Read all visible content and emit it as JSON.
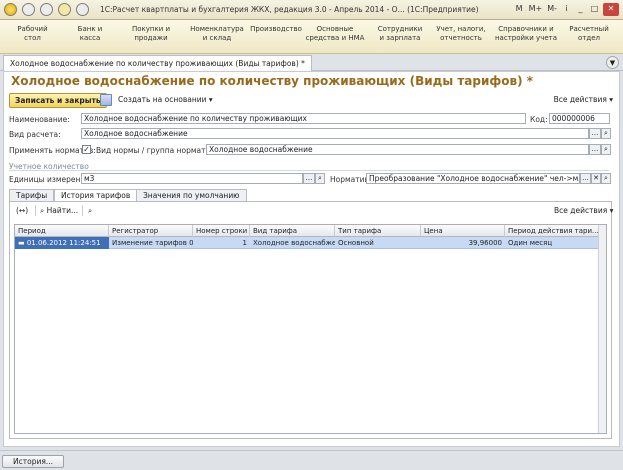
{
  "window": {
    "title": "1С:Расчет квартплаты и бухгалтерия ЖКХ, редакция 3.0 - Апрель 2014 - О...  (1С:Предприятие)",
    "controls": [
      "M",
      "M+",
      "M-",
      "i",
      "_",
      "□",
      "✕"
    ]
  },
  "sections": [
    {
      "line1": "Рабочий",
      "line2": "стол"
    },
    {
      "line1": "Банк и",
      "line2": "касса"
    },
    {
      "line1": "Покупки и",
      "line2": "продажи"
    },
    {
      "line1": "Номенклатура",
      "line2": "и склад"
    },
    {
      "line1": "Производство",
      "line2": ""
    },
    {
      "line1": "Основные",
      "line2": "средства и НМА"
    },
    {
      "line1": "Сотрудники",
      "line2": "и зарплата"
    },
    {
      "line1": "Учет, налоги,",
      "line2": "отчетность"
    },
    {
      "line1": "Справочники и",
      "line2": "настройки учета"
    },
    {
      "line1": "Расчетный",
      "line2": "отдел"
    }
  ],
  "doc_tab": "Холодное водоснабжение по количеству проживающих (Виды тарифов) *",
  "form": {
    "title": "Холодное водоснабжение по количеству проживающих (Виды тарифов) *",
    "save_close": "Записать и закрыть",
    "create_based": "Создать на основании ▾",
    "all_actions": "Все действия ▾",
    "fields": {
      "name_label": "Наименование:",
      "name_value": "Холодное водоснабжение по количеству проживающих",
      "code_label": "Код:",
      "code_value": "000000006",
      "calc_type_label": "Вид расчета:",
      "calc_type_value": "Холодное водоснабжение",
      "apply_norm_label": "Применять норматив:",
      "apply_norm_check": "✓",
      "norm_type_label": "Вид нормы / группа нормативов:",
      "norm_type_value": "Холодное водоснабжение",
      "accounting_group": "Учетное количество",
      "unit_label": "Единицы измерения:",
      "unit_value": "м3",
      "norm_label": "Норматив:",
      "norm_value": "Преобразование \"Холодное водоснабжение\" чел->м3"
    },
    "tabs": [
      "Тарифы",
      "История тарифов",
      "Значения по умолчанию"
    ],
    "table_cmd": {
      "icon": "(↔)",
      "find": "Найти...",
      "all_actions": "Все действия ▾"
    },
    "table": {
      "headers": [
        "Период",
        "Регистратор",
        "Номер строки",
        "Вид тарифа",
        "Тип тарифа",
        "Цена",
        "Период действия тари..."
      ],
      "rows": [
        [
          "01.06.2012 11:24:51",
          "Изменение тарифов 0...",
          "1",
          "Холодное водоснабже...",
          "Основной",
          "39,96000",
          "Один месяц"
        ]
      ]
    }
  },
  "statusbar": {
    "history": "История..."
  }
}
